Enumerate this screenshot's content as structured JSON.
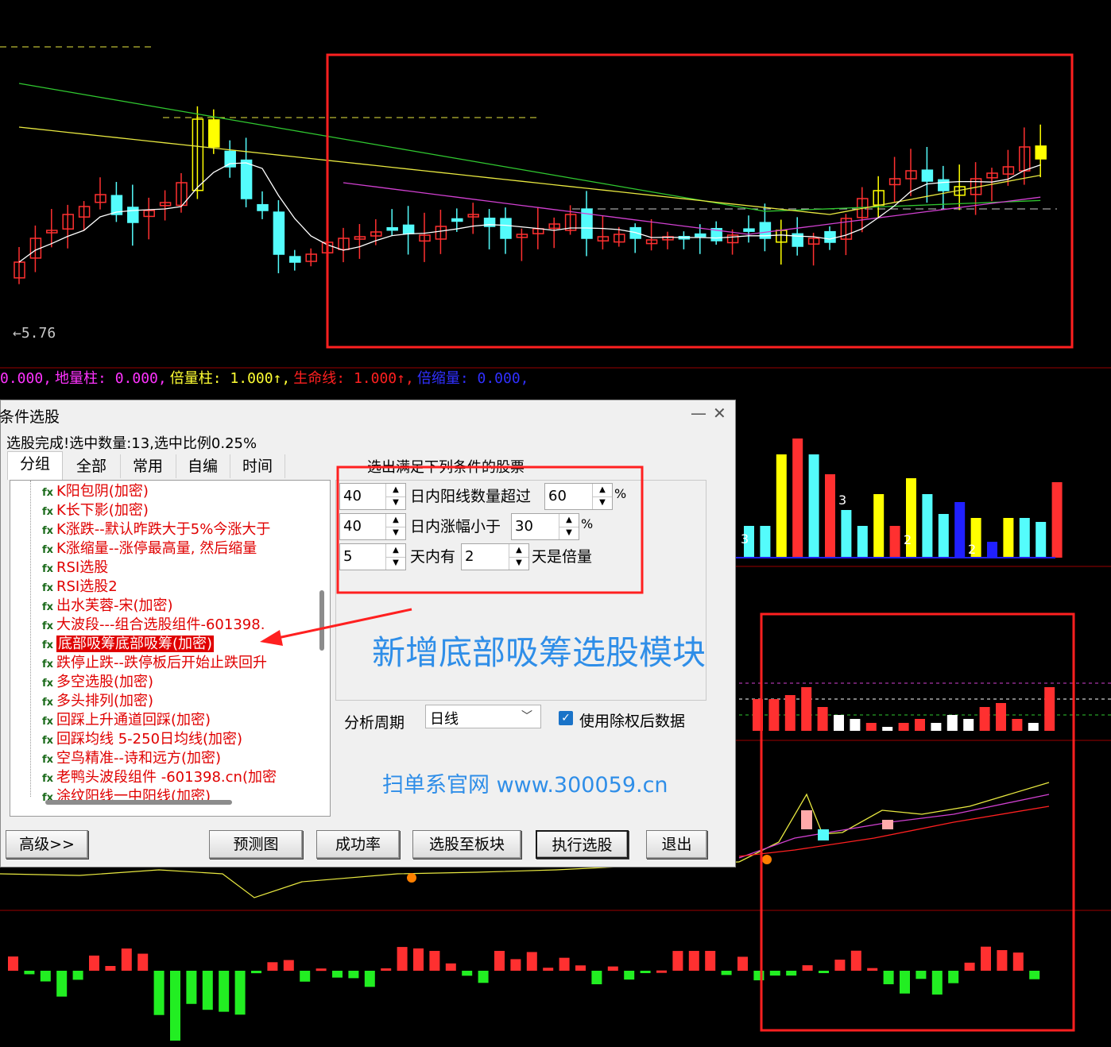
{
  "chart": {
    "low_price_label": "5.76",
    "indicator_line": [
      {
        "text": "0.000,",
        "color": "#ff33ff"
      },
      {
        "text": "地量柱: 0.000,",
        "color": "#ff33ff"
      },
      {
        "text": "倍量柱: 1.000↑,",
        "color": "#ffff33"
      },
      {
        "text": "生命线: 1.000↑,",
        "color": "#ff2020"
      },
      {
        "text": "倍缩量: 0.000,",
        "color": "#3030ff"
      }
    ],
    "volume_markers": [
      "3",
      "3",
      "2",
      "2"
    ],
    "colors": {
      "up": "#ff3030",
      "down": "#54fcfc",
      "yellow": "#ffff00",
      "ma_white": "#ffffff",
      "ma_yellow": "#e8e840",
      "ma_purple": "#d040d0",
      "ma_green": "#30c830",
      "highlight": "#ff2020"
    }
  },
  "dialog": {
    "title": "条件选股",
    "minimize_icon": "minimize-icon",
    "close_icon": "close-icon",
    "status": "选股完成!选中数量:13,选中比例0.25%",
    "tabs": [
      "分组",
      "全部",
      "常用",
      "自编",
      "时间"
    ],
    "formula_list": [
      "K阳包阴(加密)",
      "K长下影(加密)",
      "K涨跌--默认昨跌大于5%今涨大于",
      "K涨缩量--涨停最高量, 然后缩量",
      "RSI选股",
      "RSI选股2",
      "出水芙蓉-宋(加密)",
      "大波段---组合选股组件-601398.",
      "底部吸筹底部吸筹(加密)",
      "跌停止跌--跌停板后开始止跌回升",
      "多空选股(加密)",
      "多头排列(加密)",
      "回踩上升通道回踩(加密)",
      "回踩均线 5-250日均线(加密)",
      "空鸟精准--诗和远方(加密)",
      "老鸭头波段组件 -601398.cn(加密",
      "涂纹阳线一中阳线(加密)"
    ],
    "selected_index": 8,
    "panel_title": "选出满足下列条件的股票",
    "conditions": [
      {
        "value1": "40",
        "label1": "日内阳线数量超过",
        "value2": "60",
        "unit": "%"
      },
      {
        "value1": "40",
        "label1": "日内涨幅小于",
        "value2": "30",
        "unit": "%"
      },
      {
        "value1": "5",
        "label1": "天内有",
        "value2": "2",
        "unit": "天是倍量"
      }
    ],
    "cycle_label": "分析周期",
    "cycle_value": "日线",
    "checkbox_label": "使用除权后数据",
    "checkbox_checked": true,
    "buttons": {
      "advanced": "高级>>",
      "preview": "预测图",
      "success_rate": "成功率",
      "to_block": "选股至板块",
      "execute": "执行选股",
      "exit": "退出"
    }
  },
  "annotation": {
    "headline": "新增底部吸筹选股模块",
    "website": "扫单系官网 www.300059.cn"
  }
}
